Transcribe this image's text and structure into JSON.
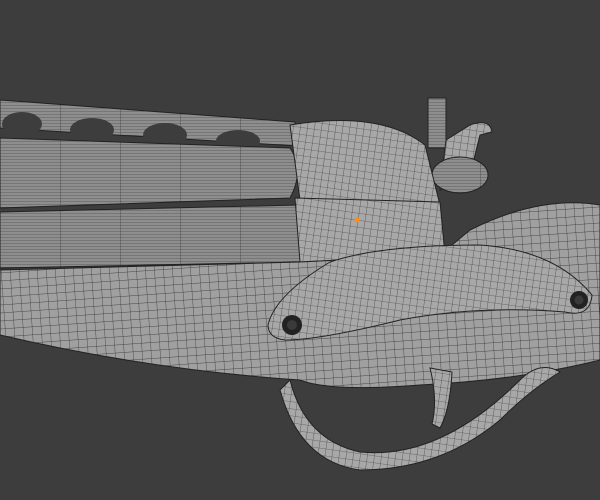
{
  "viewport": {
    "background_color": "#3d3d3d",
    "mesh_color": "#9c9c9c",
    "wire_color": "#2a2a2a",
    "selected_vertex_color": "#ff8c1a"
  }
}
